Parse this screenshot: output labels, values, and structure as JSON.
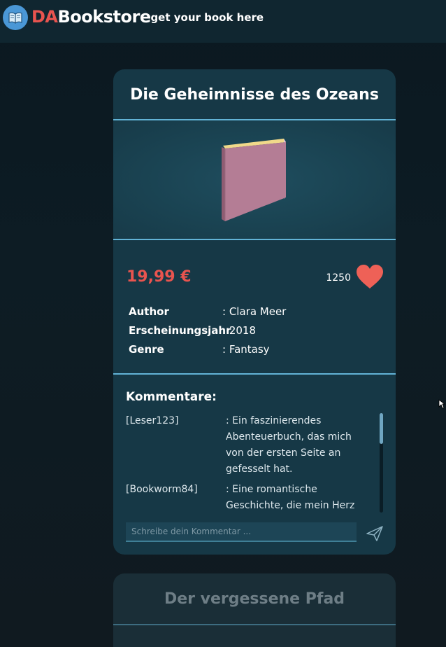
{
  "header": {
    "brand_prefix": "DA",
    "brand_name": "Bookstore",
    "tagline": "- get your book here",
    "logo_icon": "book-icon"
  },
  "book": {
    "title": "Die Geheimnisse des Ozeans",
    "price": "19,99 €",
    "likes": "1250",
    "like_icon": "heart-icon",
    "details": [
      {
        "key": "Author",
        "value": ": Clara Meer"
      },
      {
        "key": "Erscheinungsjahr",
        "value": ": 2018"
      },
      {
        "key": "Genre",
        "value": ": Fantasy"
      }
    ],
    "comments_heading": "Kommentare:",
    "comments": [
      {
        "user": "[Leser123]",
        "text": ": Ein faszinierendes Abenteuerbuch, das mich von der ersten Seite an gefesselt hat."
      },
      {
        "user": "[Bookworm84]",
        "text": ": Eine romantische Geschichte, die mein Herz"
      }
    ],
    "comment_placeholder": "Schreibe dein Kommentar ...",
    "send_icon": "send-icon"
  },
  "next_book": {
    "title": "Der vergessene Pfad"
  },
  "colors": {
    "accent": "#e8544f",
    "card_bg": "#163846",
    "separator": "#62b3d6",
    "book_cover": "#b47d95"
  }
}
